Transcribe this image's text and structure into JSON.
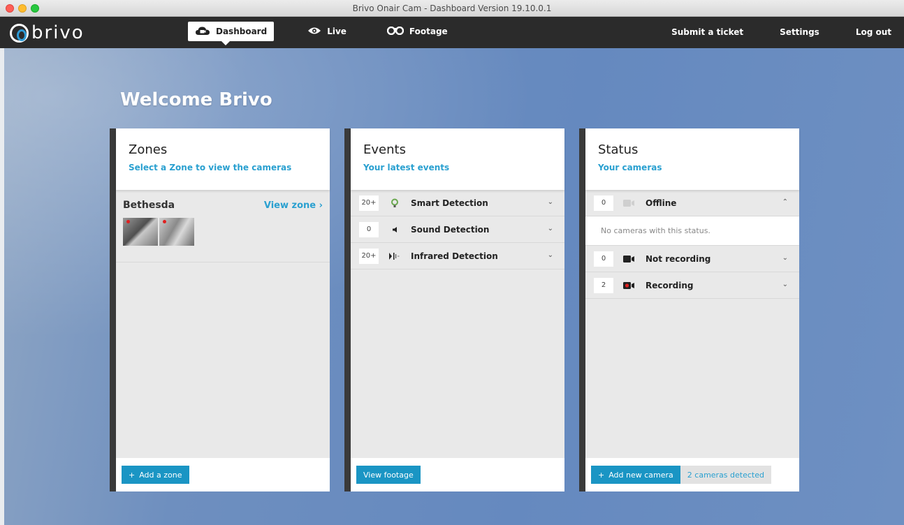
{
  "window": {
    "title": "Brivo Onair Cam - Dashboard  Version 19.10.0.1"
  },
  "navbar": {
    "logo_text": "brivo",
    "tabs": [
      {
        "label": "Dashboard",
        "icon": "cloud-camera-icon"
      },
      {
        "label": "Live",
        "icon": "eye-icon"
      },
      {
        "label": "Footage",
        "icon": "binoculars-icon"
      }
    ],
    "links": [
      "Submit a ticket",
      "Settings",
      "Log out"
    ]
  },
  "welcome": "Welcome Brivo",
  "zones": {
    "title": "Zones",
    "subtitle": "Select a Zone to view the cameras",
    "zone_name": "Bethesda",
    "view_zone": "View zone",
    "view_zone_chevron": "›",
    "add_zone": "Add a zone"
  },
  "events": {
    "title": "Events",
    "subtitle": "Your latest events",
    "rows": [
      {
        "count": "20+",
        "label": "Smart Detection",
        "icon": "lightbulb-icon"
      },
      {
        "count": "0",
        "label": "Sound Detection",
        "icon": "speaker-icon"
      },
      {
        "count": "20+",
        "label": "Infrared Detection",
        "icon": "infrared-icon"
      }
    ],
    "view_footage": "View footage"
  },
  "status": {
    "title": "Status",
    "subtitle": "Your cameras",
    "rows": [
      {
        "count": "0",
        "label": "Offline",
        "icon": "camera-offline-icon"
      },
      {
        "count": "0",
        "label": "Not recording",
        "icon": "video-camera-icon"
      },
      {
        "count": "2",
        "label": "Recording",
        "icon": "video-camera-recording-icon"
      }
    ],
    "empty_message": "No cameras with this status.",
    "add_camera": "Add new camera",
    "detected": "2 cameras detected"
  },
  "colors": {
    "accent": "#1a95c4",
    "link": "#2aa0d0",
    "nav": "#2b2b2b",
    "record": "#e02020"
  }
}
